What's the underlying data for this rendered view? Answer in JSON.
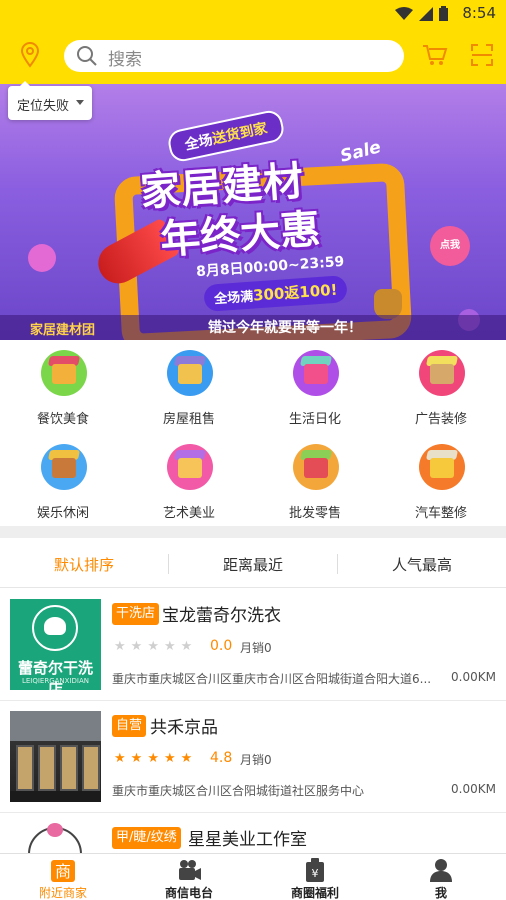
{
  "status_bar": {
    "time": "8:54",
    "wifi_icon": "wifi-icon",
    "signal_icon": "signal-icon",
    "battery_icon": "battery-icon"
  },
  "header": {
    "location_icon": "location-pin-icon",
    "search_placeholder": "搜索",
    "cart_icon": "cart-icon",
    "scan_icon": "scan-icon",
    "accent_color": "#ffde00"
  },
  "location_dropdown": {
    "label": "定位失败"
  },
  "banner": {
    "ribbon_prefix": "全场",
    "ribbon_highlight": "送货到家",
    "title_line1": "家居建材",
    "title_line2": "年终大惠",
    "sale_text": "Sale",
    "date_text": "8月8日00:00~23:59",
    "promo_prefix": "全场满",
    "promo_highlight": "300返100!",
    "dot_text": "点我",
    "brand": "家居建材团",
    "slogan": "错过今年就要再等一年！"
  },
  "categories": [
    {
      "label": "餐饮美食",
      "icon": "restaurant-icon",
      "bg": "#7bd64a",
      "box": "#f3b13c",
      "roof": "#e44d67"
    },
    {
      "label": "房屋租售",
      "icon": "house-icon",
      "bg": "#3a9cf0",
      "box": "#f2c24e",
      "roof": "#8c7bd8"
    },
    {
      "label": "生活日化",
      "icon": "daily-goods-icon",
      "bg": "#b04ee8",
      "box": "#f1508a",
      "roof": "#6fd3c0"
    },
    {
      "label": "广告装修",
      "icon": "windmill-icon",
      "bg": "#f0467a",
      "box": "#d6a86a",
      "roof": "#f2e05c"
    },
    {
      "label": "娱乐休闲",
      "icon": "entertainment-icon",
      "bg": "#4aa8f2",
      "box": "#c97a3a",
      "roof": "#f0c040"
    },
    {
      "label": "艺术美业",
      "icon": "art-beauty-icon",
      "bg": "#f25aa8",
      "box": "#f7c45a",
      "roof": "#b36ee6"
    },
    {
      "label": "批发零售",
      "icon": "wholesale-icon",
      "bg": "#f3a73a",
      "box": "#e44d55",
      "roof": "#8ccf56"
    },
    {
      "label": "汽车整修",
      "icon": "car-repair-icon",
      "bg": "#f57a2a",
      "box": "#f6c83c",
      "roof": "#e8e0c8"
    }
  ],
  "sort_tabs": [
    {
      "label": "默认排序",
      "active": true
    },
    {
      "label": "距离最近",
      "active": false
    },
    {
      "label": "人气最高",
      "active": false
    }
  ],
  "shops": [
    {
      "badge": "干洗店",
      "name": "宝龙蕾奇尔洗衣",
      "rating": 0,
      "score": "0.0",
      "sales": "月销0",
      "address": "重庆市重庆城区合川区重庆市合川区合阳城街道合阳大道6...",
      "distance": "0.00KM",
      "thumb_title": "蕾奇尔干洗店",
      "thumb_sub": "LEIQIERGANXIDIAN"
    },
    {
      "badge": "自营",
      "name": "共禾京品",
      "rating": 5,
      "score": "4.8",
      "sales": "月销0",
      "address": "重庆市重庆城区合川区合阳城街道社区服务中心",
      "distance": "0.00KM"
    },
    {
      "badge": "甲/睫/纹绣",
      "name": "星星美业工作室"
    }
  ],
  "bottom_nav": [
    {
      "label": "附近商家",
      "icon": "shop-icon",
      "active": true
    },
    {
      "label": "商信电台",
      "icon": "video-camera-icon",
      "active": false
    },
    {
      "label": "商圈福利",
      "icon": "coupon-bag-icon",
      "active": false
    },
    {
      "label": "我",
      "icon": "user-icon",
      "active": false
    }
  ],
  "colors": {
    "accent_orange": "#ff8a00",
    "header_yellow": "#ffde00"
  }
}
